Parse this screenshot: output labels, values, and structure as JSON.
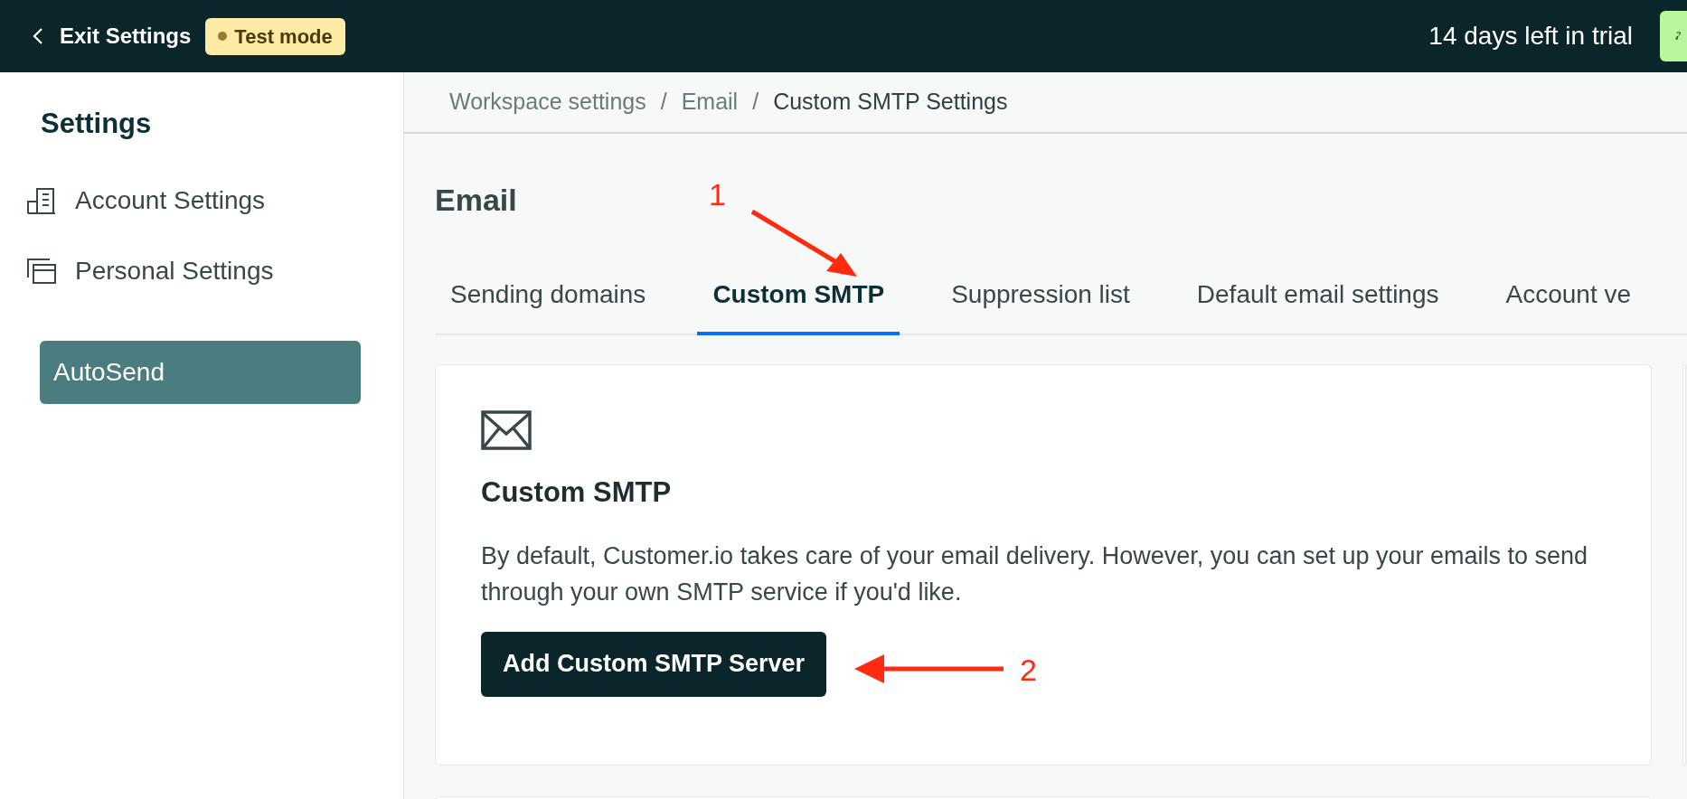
{
  "top_bar": {
    "back_label": "Exit Settings",
    "mode_badge": "Test mode",
    "trial_text": "14 days left in trial"
  },
  "sidebar": {
    "title": "Settings",
    "items": [
      {
        "label": "Account Settings",
        "kind": "building"
      },
      {
        "label": "Personal Settings",
        "kind": "windows"
      }
    ],
    "workspaces": [
      {
        "label": "AutoSend",
        "selected": true
      }
    ]
  },
  "breadcrumb": {
    "separator": "/",
    "items": [
      "Workspace settings",
      "Email",
      "Custom SMTP Settings"
    ]
  },
  "page_title": "Email",
  "tabs": [
    {
      "label": "Sending domains",
      "selected": false
    },
    {
      "label": "Custom SMTP",
      "selected": true
    },
    {
      "label": "Suppression list",
      "selected": false
    },
    {
      "label": "Default email settings",
      "selected": false
    },
    {
      "label": "Account ve",
      "selected": false
    }
  ],
  "card": {
    "title": "Custom SMTP",
    "description": "By default, Customer.io takes care of your email delivery. However, you can set up your emails to send through your own SMTP service if you'd like.",
    "button": "Add Custom SMTP Server"
  },
  "annotations": [
    "1",
    "2"
  ]
}
